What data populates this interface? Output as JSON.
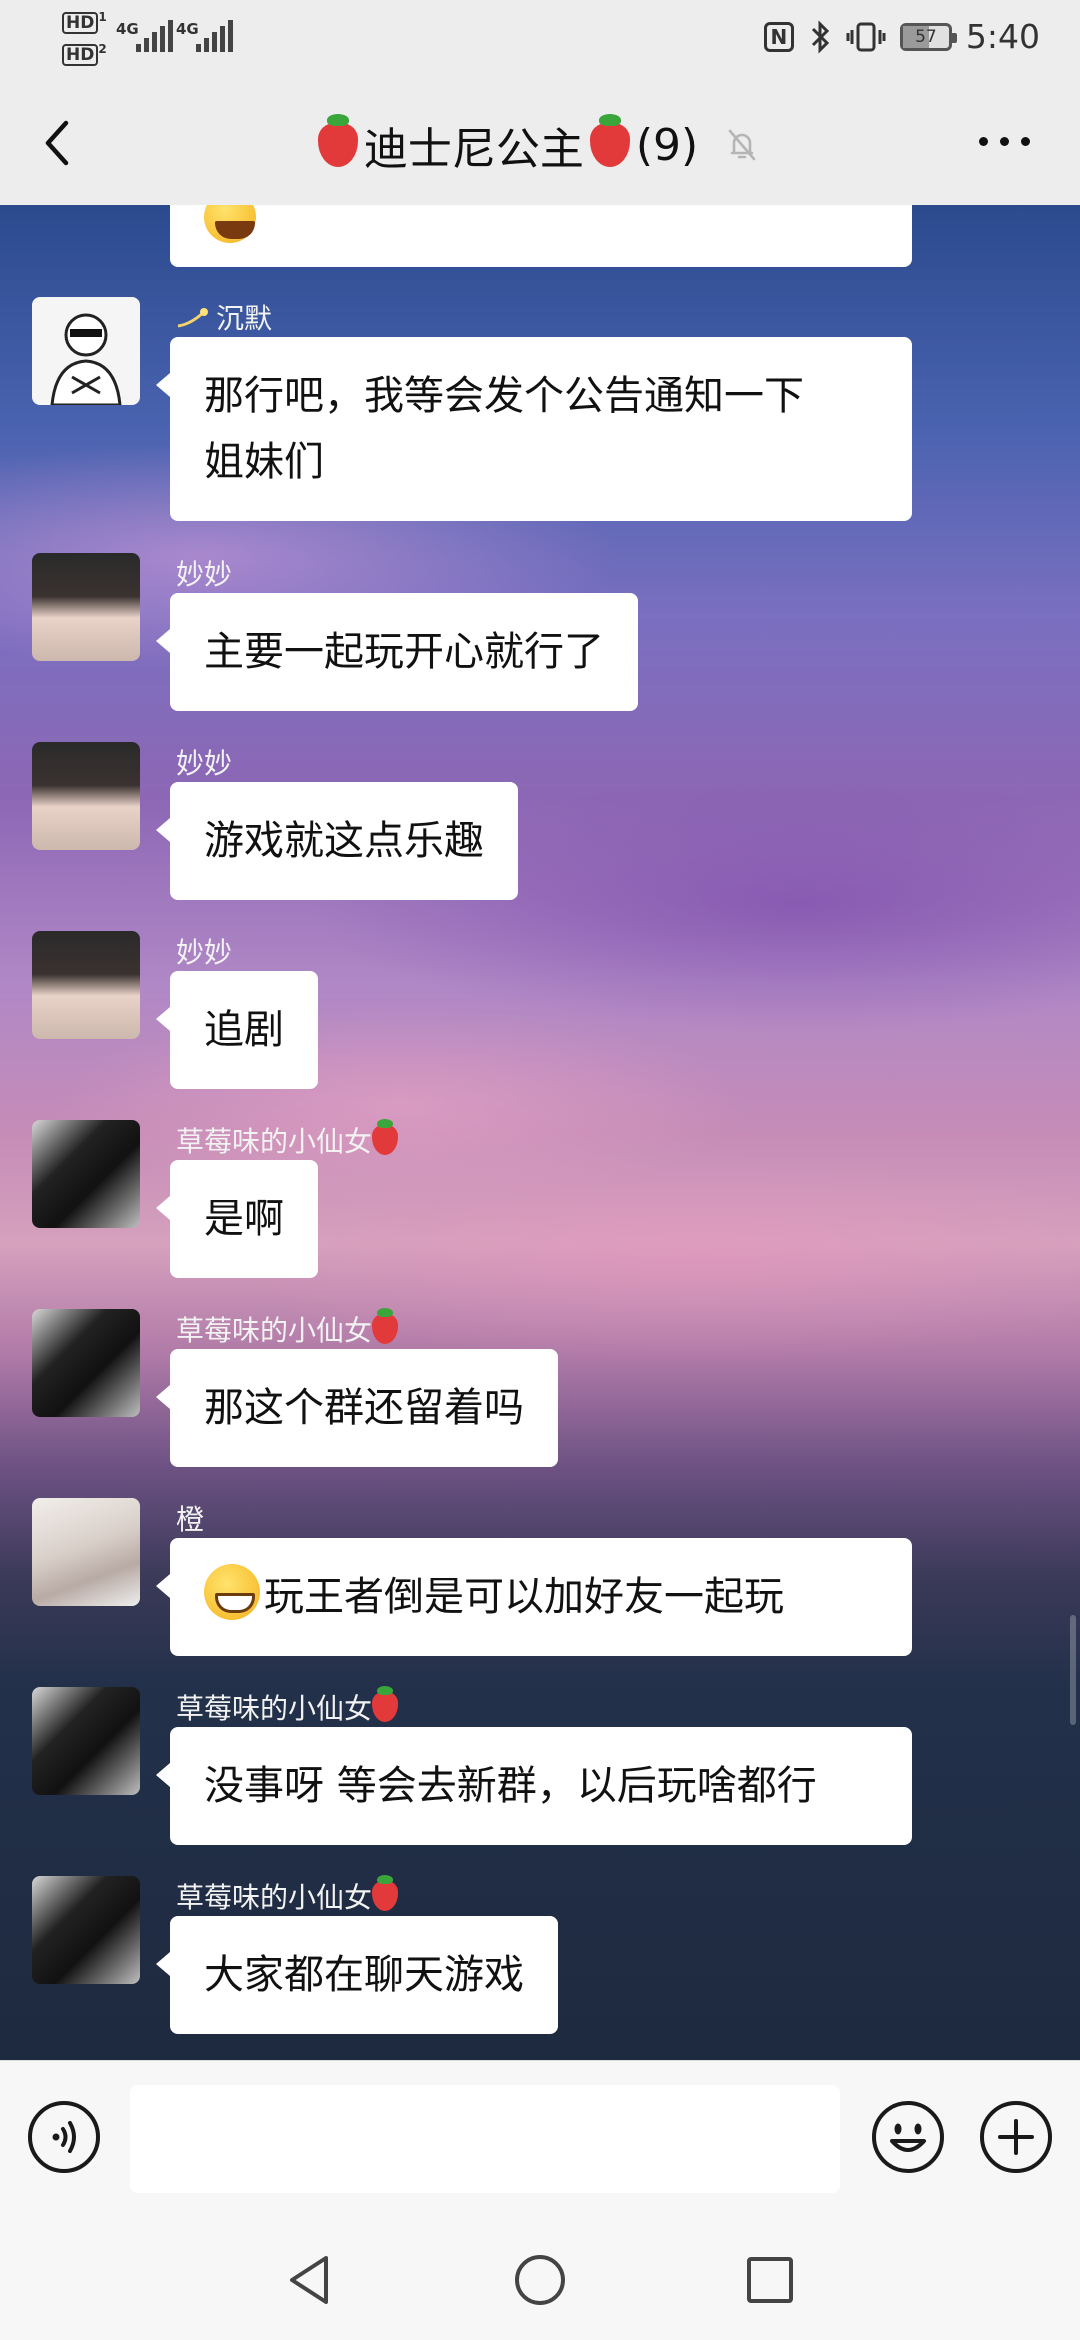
{
  "status_bar": {
    "hd1": "HD",
    "hd1_sub": "1",
    "hd2": "HD",
    "hd2_sub": "2",
    "net1": "4G",
    "net2": "4G",
    "battery": "57",
    "battery_level_percent": 57,
    "time": "5:40",
    "icons": [
      "nfc-icon",
      "bluetooth-icon",
      "vibrate-icon",
      "battery-icon"
    ]
  },
  "header": {
    "title": "迪士尼公主",
    "member_count": "(9)",
    "icons": [
      "back-arrow-icon",
      "strawberry-icon",
      "bell-muted-icon",
      "more-icon"
    ]
  },
  "messages": [
    {
      "sender": "",
      "text": "",
      "partial": true,
      "emoji": "laughing-crying-emoji-icon"
    },
    {
      "sender": "沉默",
      "text": "那行吧，我等会发个公告通知一下姐妹们",
      "line1": "那行吧，我等会发个公告通知一下",
      "line2": "姐妹们",
      "avatar": "sketch-avatar"
    },
    {
      "sender": "妙妙",
      "text": "主要一起玩开心就行了",
      "avatar": "girl-avatar"
    },
    {
      "sender": "妙妙",
      "text": "游戏就这点乐趣",
      "avatar": "girl-avatar"
    },
    {
      "sender": "妙妙",
      "text": "追剧",
      "avatar": "girl-avatar"
    },
    {
      "sender": "草莓味的小仙女",
      "text": "是啊",
      "avatar": "selfie-avatar"
    },
    {
      "sender": "草莓味的小仙女",
      "text": "那这个群还留着吗",
      "avatar": "selfie-avatar"
    },
    {
      "sender": "橙",
      "text": "玩王者倒是可以加好友一起玩",
      "emoji": "grinning-emoji-icon",
      "avatar": "sleeping-girl-avatar"
    },
    {
      "sender": "草莓味的小仙女",
      "text": "没事呀 等会去新群，以后玩啥都行",
      "avatar": "selfie-avatar"
    },
    {
      "sender": "草莓味的小仙女",
      "text": "大家都在聊天游戏",
      "avatar": "selfie-avatar"
    }
  ],
  "input_bar": {
    "value": "",
    "placeholder": "",
    "icons": [
      "voice-icon",
      "emoji-icon",
      "plus-icon"
    ]
  },
  "nav_bar": {
    "icons": [
      "nav-back-icon",
      "nav-home-icon",
      "nav-recent-icon"
    ]
  },
  "colors": {
    "header_bg": "#ededed",
    "bubble_bg": "#ffffff",
    "name_text": "#f2f2f2"
  }
}
